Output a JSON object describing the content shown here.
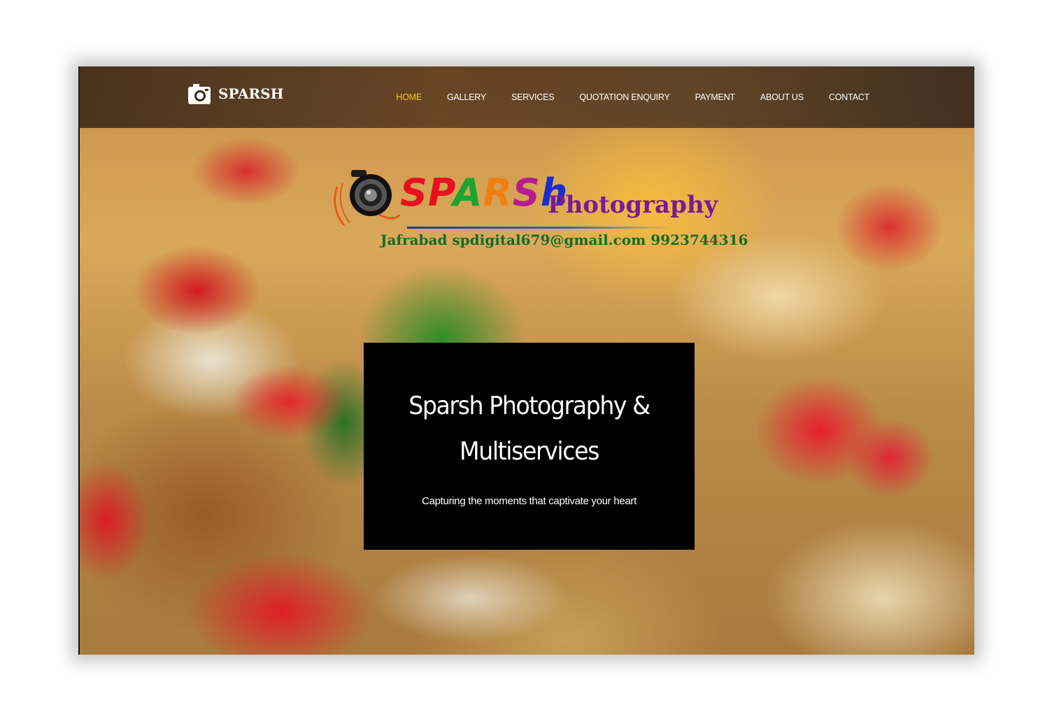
{
  "brand": {
    "name": "SPARSH",
    "icon": "camera-icon"
  },
  "nav": {
    "items": [
      {
        "label": "HOME",
        "active": true
      },
      {
        "label": "GALLERY",
        "active": false
      },
      {
        "label": "SERVICES",
        "active": false
      },
      {
        "label": "QUOTATION ENQUIRY",
        "active": false
      },
      {
        "label": "PAYMENT",
        "active": false
      },
      {
        "label": "ABOUT US",
        "active": false
      },
      {
        "label": "CONTACT",
        "active": false
      }
    ],
    "active_color": "#f5c518"
  },
  "logo": {
    "sparsh_letters": [
      "S",
      "P",
      "A",
      "R",
      "S",
      "h"
    ],
    "photography": "Photography",
    "contact_line": "Jafrabad spdigital679@gmail.com 9923744316"
  },
  "hero": {
    "title": "Sparsh Photography & Multiservices",
    "subtitle": "Capturing the moments that captivate your heart"
  }
}
